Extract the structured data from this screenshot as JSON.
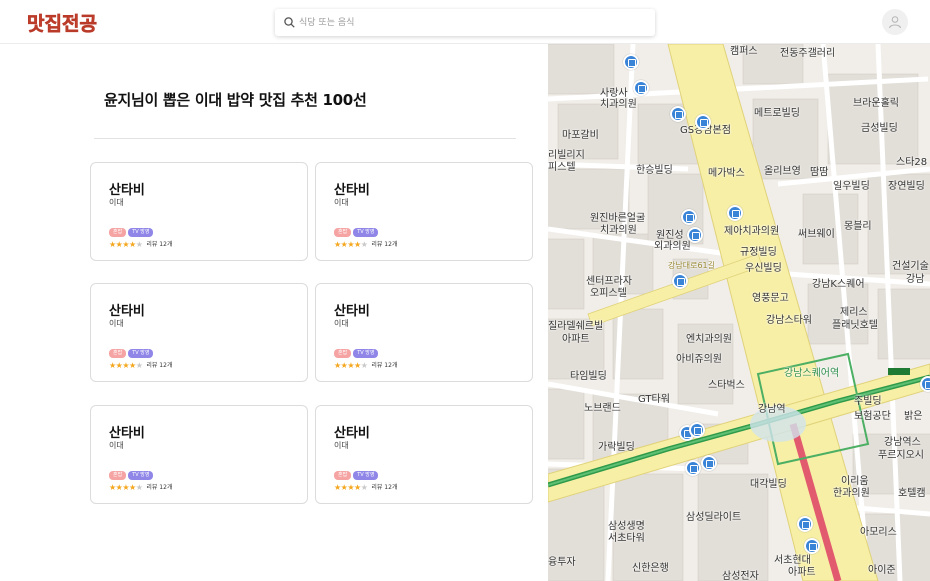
{
  "header": {
    "logo_text": "맛집전공",
    "search_placeholder": "식당 또는 음식"
  },
  "colors": {
    "brand": "#e2513a",
    "tag_pink": "#f5a3a3",
    "tag_blue": "#8f86e8",
    "star": "#f4a71e"
  },
  "main": {
    "title": "윤지님이 뽑은 이대 밥약 맛집 추천 100선",
    "cards": [
      {
        "name": "산타비",
        "area": "이대",
        "tag1": "혼밥",
        "tag2": "TV 방영",
        "rating": 4,
        "review": "리뷰 12개"
      },
      {
        "name": "산타비",
        "area": "이대",
        "tag1": "혼밥",
        "tag2": "TV 방영",
        "rating": 4,
        "review": "리뷰 12개"
      },
      {
        "name": "산타비",
        "area": "이대",
        "tag1": "혼밥",
        "tag2": "TV 방영",
        "rating": 4,
        "review": "리뷰 12개"
      },
      {
        "name": "산타비",
        "area": "이대",
        "tag1": "혼밥",
        "tag2": "TV 방영",
        "rating": 4,
        "review": "리뷰 12개"
      },
      {
        "name": "산타비",
        "area": "이대",
        "tag1": "혼밥",
        "tag2": "TV 방영",
        "rating": 4,
        "review": "리뷰 12개"
      },
      {
        "name": "산타비",
        "area": "이대",
        "tag1": "혼밥",
        "tag2": "TV 방영",
        "rating": 4,
        "review": "리뷰 12개"
      }
    ]
  },
  "map": {
    "labels": [
      "캠퍼스",
      "전동주갤러리",
      "사랑사",
      "치과의원",
      "마포갈비",
      "브라운홀릭",
      "메트로빌딩",
      "GS강남본점",
      "금성빌딩",
      "리빌리지",
      "피스텔",
      "한승빌딩",
      "메가박스",
      "올리브영",
      "땀땀",
      "일우빌딩",
      "장연빌딩",
      "스타28",
      "원진바른얼굴",
      "치과의원",
      "원진성",
      "외과의원",
      "제아치과의원",
      "써브웨이",
      "몽블리",
      "규정빌딩",
      "우신빌딩",
      "센터프라자",
      "오피스텔",
      "건설기술",
      "강남",
      "영풍문고",
      "강남K스퀘어",
      "제리스",
      "플래닛호텔",
      "강남스타워",
      "엔치과의원",
      "질라델쉐르빌",
      "아파트",
      "아비쥬의원",
      "강남스퀘어역",
      "타임빌딩",
      "스타벅스",
      "GT타워",
      "노브랜드",
      "강남역",
      "주빌딩",
      "보험공단",
      "밝은",
      "가락빌딩",
      "강남역스",
      "푸르지오시",
      "대각빌딩",
      "이리움",
      "한과의원",
      "호텔캠",
      "삼성딜라이트",
      "아모리스",
      "삼성생명",
      "서초타워",
      "서초현대",
      "아파트",
      "신한은행",
      "삼성전자",
      "아이준",
      "융투자",
      "강남대로61길"
    ]
  }
}
